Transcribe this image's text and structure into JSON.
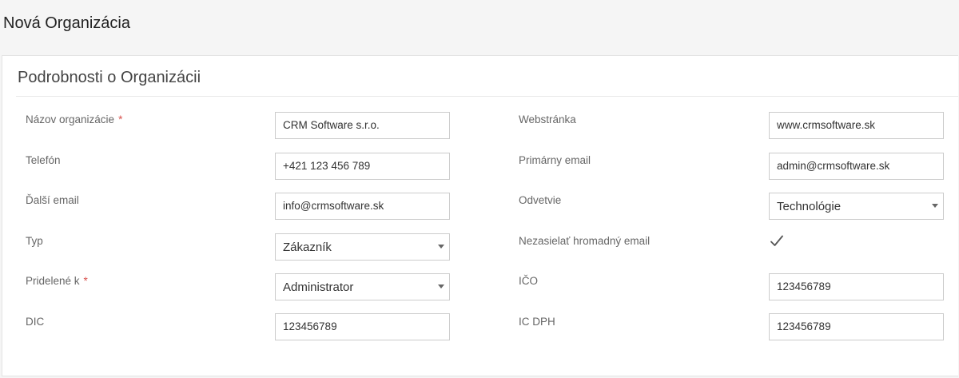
{
  "page": {
    "title": "Nová Organizácia"
  },
  "panel": {
    "title": "Podrobnosti o Organizácii"
  },
  "required_mark": "*",
  "fields": {
    "name": {
      "label": "Názov organizácie",
      "value": "CRM Software s.r.o.",
      "required": true
    },
    "website": {
      "label": "Webstránka",
      "value": "www.crmsoftware.sk"
    },
    "phone": {
      "label": "Telefón",
      "value": "+421 123 456 789"
    },
    "primary_email": {
      "label": "Primárny email",
      "value": "admin@crmsoftware.sk"
    },
    "other_email": {
      "label": "Ďalší email",
      "value": "info@crmsoftware.sk"
    },
    "industry": {
      "label": "Odvetvie",
      "value": "Technológie",
      "type": "select"
    },
    "type": {
      "label": "Typ",
      "value": "Zákazník",
      "type": "select"
    },
    "no_mass_email": {
      "label": "Nezasielať hromadný email",
      "checked": true,
      "icon": "checkmark-icon"
    },
    "assigned_to": {
      "label": "Pridelené k",
      "value": "Administrator",
      "type": "select",
      "required": true
    },
    "ico": {
      "label": "IČO",
      "value": "123456789"
    },
    "dic": {
      "label": "DIC",
      "value": "123456789"
    },
    "ic_dph": {
      "label": "IC DPH",
      "value": "123456789"
    }
  }
}
